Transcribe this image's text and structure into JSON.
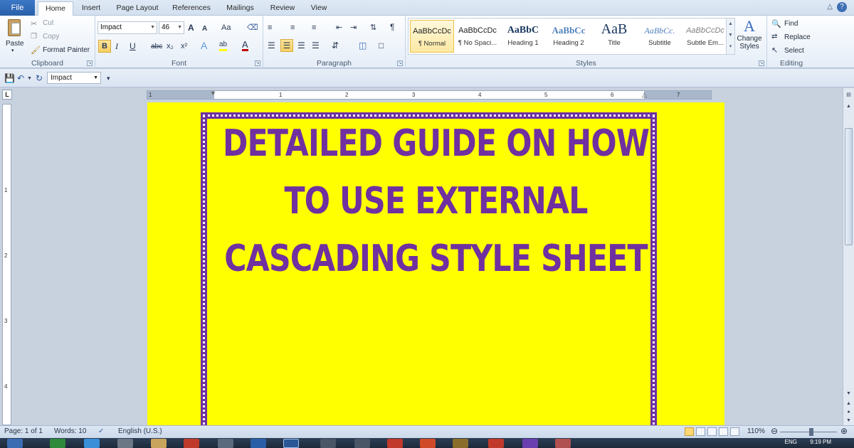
{
  "tabs": [
    "File",
    "Home",
    "Insert",
    "Page Layout",
    "References",
    "Mailings",
    "Review",
    "View"
  ],
  "active_tab": "Home",
  "clipboard": {
    "paste": "Paste",
    "cut": "Cut",
    "copy": "Copy",
    "format_painter": "Format Painter",
    "label": "Clipboard"
  },
  "font": {
    "family": "Impact",
    "size": "46",
    "label": "Font",
    "grow": "A",
    "shrink": "A",
    "change_case": "Aa",
    "bold": "B",
    "italic": "I",
    "underline": "U",
    "strike": "abc",
    "subscript": "x₂",
    "superscript": "x²",
    "effects": "A",
    "highlight": "ab",
    "color": "A"
  },
  "paragraph": {
    "label": "Paragraph",
    "pilcrow": "¶"
  },
  "styles": {
    "label": "Styles",
    "items": [
      {
        "sample": "AaBbCcDc",
        "name": "¶ Normal",
        "active": true
      },
      {
        "sample": "AaBbCcDc",
        "name": "¶ No Spaci..."
      },
      {
        "sample": "AaBbC",
        "name": "Heading 1"
      },
      {
        "sample": "AaBbCc",
        "name": "Heading 2"
      },
      {
        "sample": "AaB",
        "name": "Title"
      },
      {
        "sample": "AaBbCc.",
        "name": "Subtitle"
      },
      {
        "sample": "AaBbCcDc",
        "name": "Subtle Em..."
      }
    ],
    "change_styles": "Change Styles"
  },
  "editing": {
    "label": "Editing",
    "find": "Find",
    "replace": "Replace",
    "select": "Select"
  },
  "qat": {
    "font": "Impact"
  },
  "ruler": {
    "corner": "L",
    "numbers": [
      "1",
      "1",
      "2",
      "3",
      "4",
      "5",
      "6",
      "7"
    ]
  },
  "document": {
    "title_lines": [
      "DETAILED GUIDE ON HOW",
      "TO USE EXTERNAL",
      "CASCADING STYLE SHEET"
    ],
    "page_color": "#ffff00",
    "text_color": "#7030a0"
  },
  "status": {
    "page": "Page: 1 of 1",
    "words": "Words: 10",
    "language": "English (U.S.)",
    "zoom": "110%"
  },
  "tray": {
    "lang": "ENG",
    "time": "9:19 PM"
  }
}
